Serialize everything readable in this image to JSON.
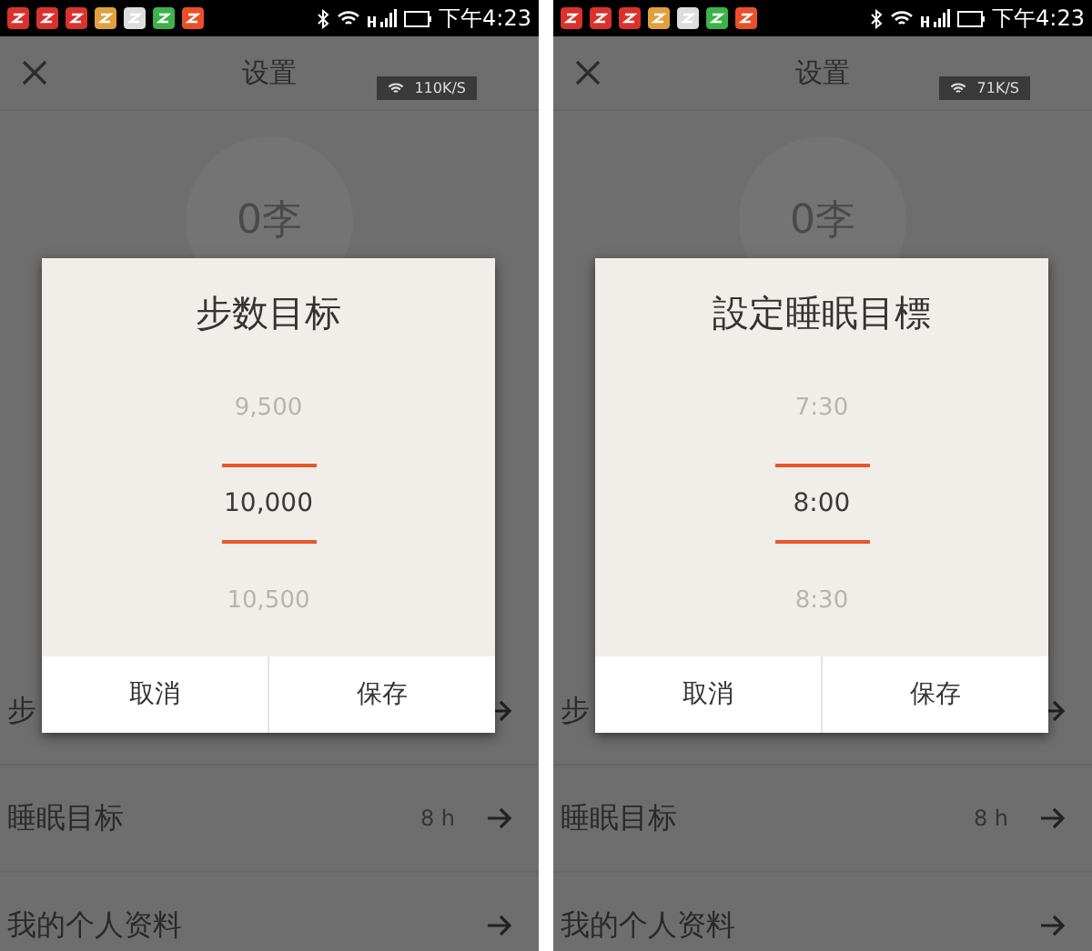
{
  "phones": [
    {
      "status_bar": {
        "time": "下午4:23"
      },
      "header": {
        "title": "设置",
        "speed": "110K/S"
      },
      "avatar_text": "0李",
      "rows": [
        {
          "label": "步"
        },
        {
          "label": "睡眠目标",
          "value": "8 h"
        },
        {
          "label": "我的个人资料"
        }
      ],
      "dialog": {
        "title": "步数目标",
        "options": [
          {
            "label": "9,500",
            "selected": false
          },
          {
            "label": "10,000",
            "selected": true
          },
          {
            "label": "10,500",
            "selected": false
          }
        ],
        "buttons": [
          "取消",
          "保存"
        ]
      }
    },
    {
      "status_bar": {
        "time": "下午4:23"
      },
      "header": {
        "title": "设置",
        "speed": "71K/S"
      },
      "avatar_text": "0李",
      "rows": [
        {
          "label": "步"
        },
        {
          "label": "睡眠目标",
          "value": "8 h"
        },
        {
          "label": "我的个人资料"
        }
      ],
      "dialog": {
        "title": "設定睡眠目標",
        "options": [
          {
            "label": "7:30",
            "selected": false
          },
          {
            "label": "8:00",
            "selected": true
          },
          {
            "label": "8:30",
            "selected": false
          }
        ],
        "buttons": [
          "取消",
          "保存"
        ]
      }
    }
  ]
}
